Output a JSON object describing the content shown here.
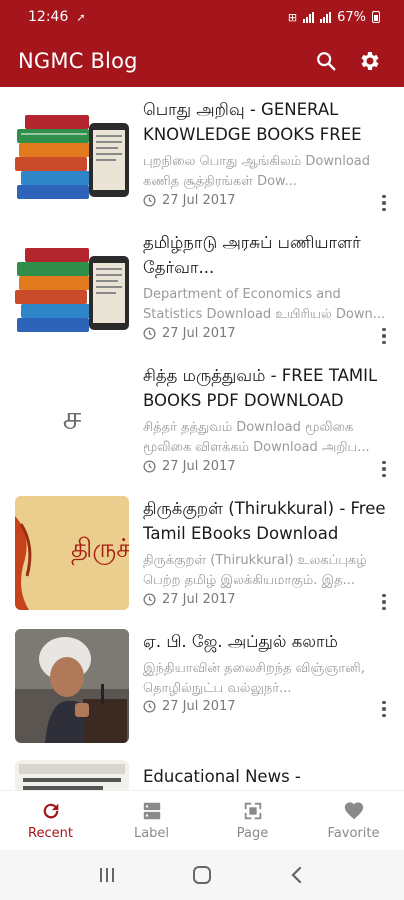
{
  "status": {
    "time": "12:46",
    "battery": "67%"
  },
  "app": {
    "title": "NGMC Blog"
  },
  "posts": [
    {
      "title": "பொது அறிவு - GENERAL KNOWLEDGE BOOKS FREE DO...",
      "desc": "புறநிலை பொது ஆங்கிலம் Download கணித சூத்திரங்கள் Dow...",
      "date": "27 Jul 2017",
      "thumb": "books"
    },
    {
      "title": "தமிழ்நாடு அரசுப் பணியாளர் தேர்வா...",
      "desc": "Department of Economics and Statistics Download உயிரியல் Down...",
      "date": "27 Jul 2017",
      "thumb": "books"
    },
    {
      "title": "சித்த மருத்துவம் - FREE TAMIL BOOKS PDF DOWNLOAD",
      "desc": "சித்தர் தத்துவம் Download மூலிகை மூலிகை விளக்கம் Download அறிப...",
      "date": "27 Jul 2017",
      "thumb": "letter",
      "letter": "ச"
    },
    {
      "title": "திருக்குறள் (Thirukkural) - Free Tamil EBooks Download",
      "desc": "திருக்குறள் (Thirukkural) உலகப்புகழ் பெற்ற தமிழ் இலக்கியமாகும். இத...",
      "date": "27 Jul 2017",
      "thumb": "kural",
      "cover_text": "திருச்"
    },
    {
      "title": "ஏ. பி. ஜே. அப்துல் கலாம்",
      "desc": "இந்தியாவின் தலைசிறந்த விஞ்ஞானி, தொழில்நுட்ப வல்லுநர்...",
      "date": "27 Jul 2017",
      "thumb": "portrait"
    },
    {
      "title": "Educational News -",
      "desc": "",
      "date": "",
      "thumb": "news"
    }
  ],
  "nav": [
    {
      "label": "Recent",
      "icon": "refresh-icon",
      "active": true
    },
    {
      "label": "Label",
      "icon": "label-icon",
      "active": false
    },
    {
      "label": "Page",
      "icon": "page-icon",
      "active": false
    },
    {
      "label": "Favorite",
      "icon": "heart-icon",
      "active": false
    }
  ],
  "colors": {
    "primary": "#a4161c",
    "muted": "#9a9a9a"
  }
}
